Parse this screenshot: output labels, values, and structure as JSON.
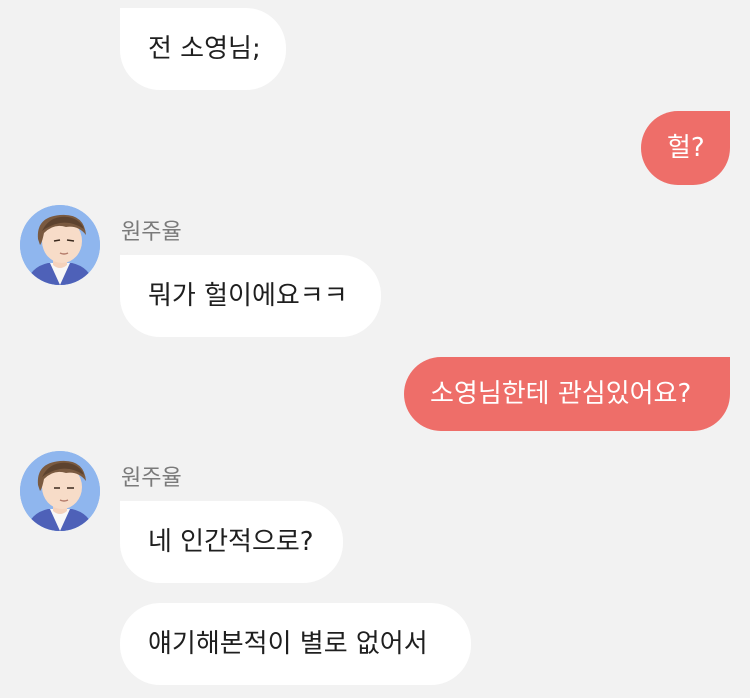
{
  "messages": [
    {
      "side": "incoming",
      "text": "전 소영님;"
    },
    {
      "side": "outgoing",
      "text": "헐?"
    },
    {
      "side": "incoming",
      "sender": "원주율",
      "text": "뭐가 헐이에요ㅋㅋ"
    },
    {
      "side": "outgoing",
      "text": "소영님한테 관심있어요?"
    },
    {
      "side": "incoming",
      "sender": "원주율",
      "text": "네 인간적으로?"
    },
    {
      "side": "incoming",
      "text": "얘기해본적이 별로 없어서"
    }
  ],
  "colors": {
    "background": "#f2f2f2",
    "incoming_bubble": "#ffffff",
    "outgoing_bubble": "#ee6e69",
    "sender_name": "#7a7a7a"
  }
}
